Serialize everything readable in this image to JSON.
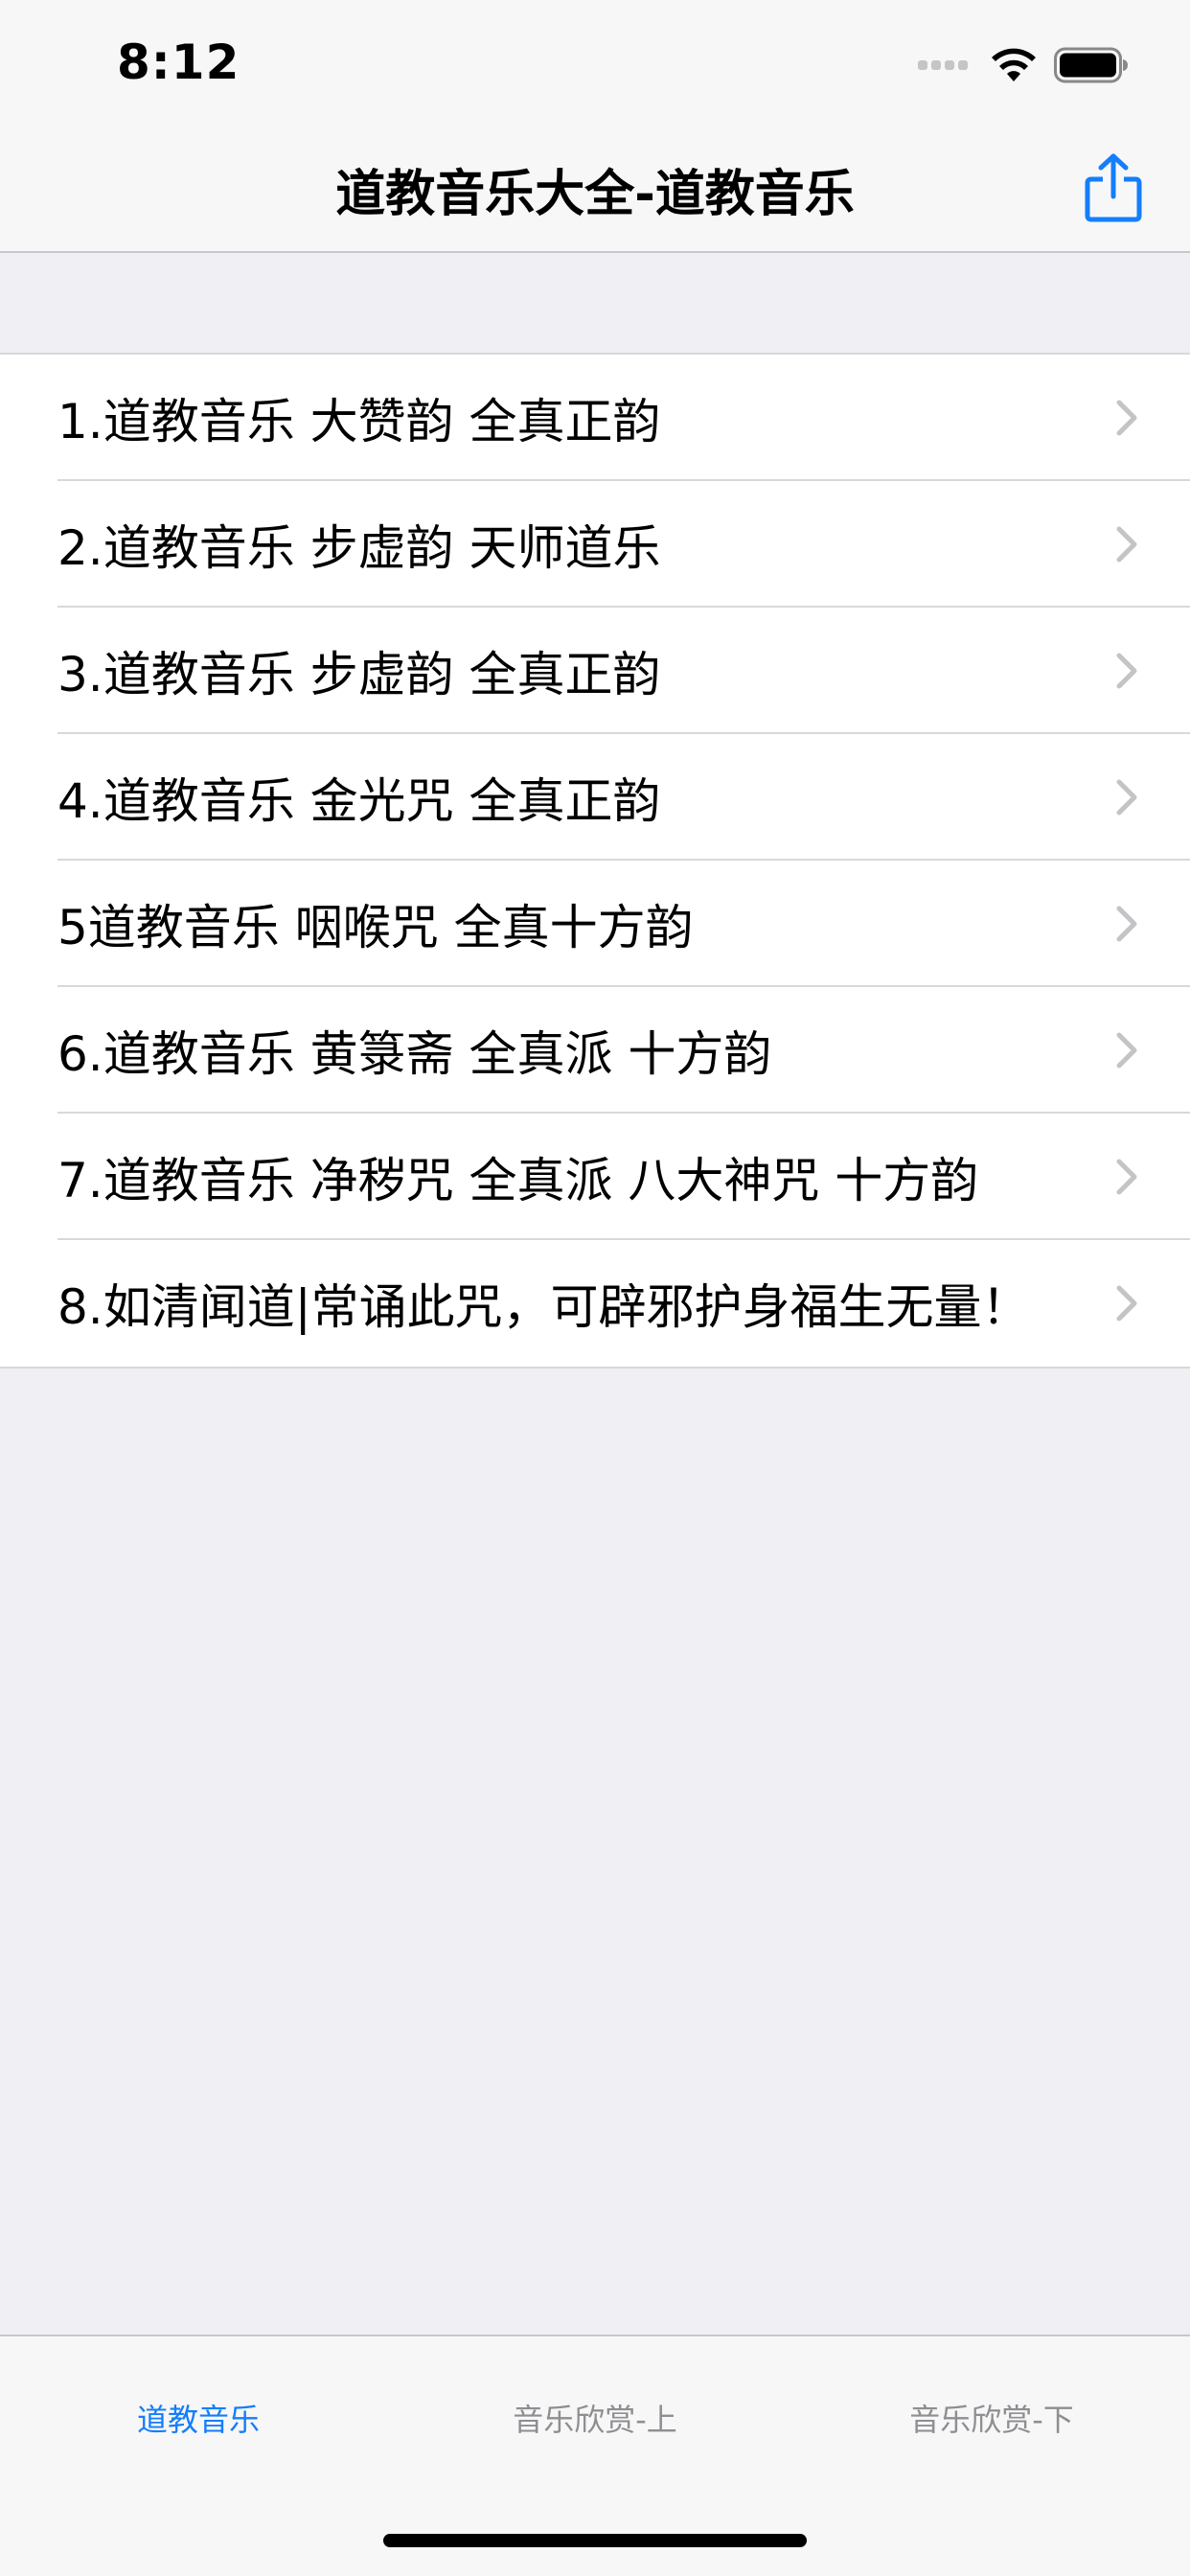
{
  "status_bar": {
    "time": "8:12"
  },
  "nav": {
    "title": "道教音乐大全-道教音乐",
    "share_icon": "share-icon"
  },
  "list": {
    "items": [
      {
        "label": "1.道教音乐 大赞韵 全真正韵"
      },
      {
        "label": "2.道教音乐 步虚韵 天师道乐"
      },
      {
        "label": "3.道教音乐 步虚韵 全真正韵"
      },
      {
        "label": "4.道教音乐 金光咒 全真正韵"
      },
      {
        "label": "5道教音乐 咽喉咒 全真十方韵"
      },
      {
        "label": "6.道教音乐 黄箓斋 全真派 十方韵"
      },
      {
        "label": "7.道教音乐 净秽咒 全真派 八大神咒 十方韵"
      },
      {
        "label": "8.如清闻道|常诵此咒，可辟邪护身福生无量！"
      }
    ]
  },
  "tab_bar": {
    "tabs": [
      {
        "label": "道教音乐",
        "active": true
      },
      {
        "label": "音乐欣赏-上",
        "active": false
      },
      {
        "label": "音乐欣赏-下",
        "active": false
      }
    ]
  },
  "colors": {
    "accent": "#147EFB",
    "inactive_tab": "#8E8E93",
    "background": "#EFEFF4"
  }
}
